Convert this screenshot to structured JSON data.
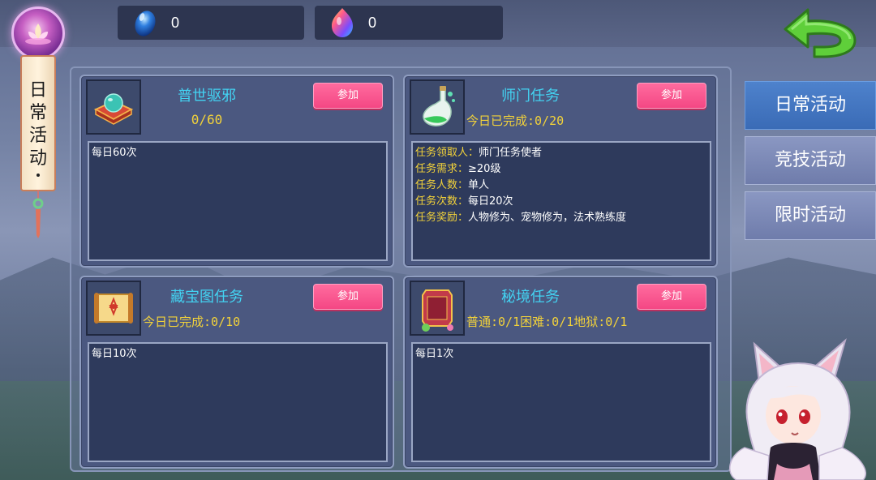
{
  "currencies": [
    {
      "icon": "blue-gem-icon",
      "value": "0"
    },
    {
      "icon": "rainbow-gem-icon",
      "value": "0"
    }
  ],
  "side_tag": {
    "title_chars": [
      "日",
      "常",
      "活",
      "动"
    ]
  },
  "tabs": [
    {
      "label": "日常活动",
      "active": true
    },
    {
      "label": "竞技活动",
      "active": false
    },
    {
      "label": "限时活动",
      "active": false
    }
  ],
  "cards": [
    {
      "title": "普世驱邪",
      "progress": "0/60",
      "button": "参加",
      "icon": "jade-orb-icon",
      "desc": "每日60次"
    },
    {
      "title": "师门任务",
      "progress": "今日已完成:0/20",
      "button": "参加",
      "icon": "potion-vase-icon",
      "details": [
        {
          "key": "任务领取人：",
          "value": "师门任务使者"
        },
        {
          "key": "任务需求：",
          "value": "≥20级"
        },
        {
          "key": "任务人数：",
          "value": "单人"
        },
        {
          "key": "任务次数：",
          "value": "每日20次"
        },
        {
          "key": "任务奖励：",
          "value": "人物修为、宠物修为，法术熟练度"
        }
      ]
    },
    {
      "title": "藏宝图任务",
      "progress": "今日已完成:0/10",
      "button": "参加",
      "icon": "treasure-map-scroll-icon",
      "desc": "每日10次"
    },
    {
      "title": "秘境任务",
      "progress": "普通:0/1困难:0/1地狱:0/1",
      "button": "参加",
      "icon": "secret-realm-token-icon",
      "desc": "每日1次"
    }
  ],
  "colors": {
    "title": "#43d3f2",
    "progress": "#f2d23a",
    "join_button": "#f44784",
    "active_tab": "#3a6bb6"
  }
}
